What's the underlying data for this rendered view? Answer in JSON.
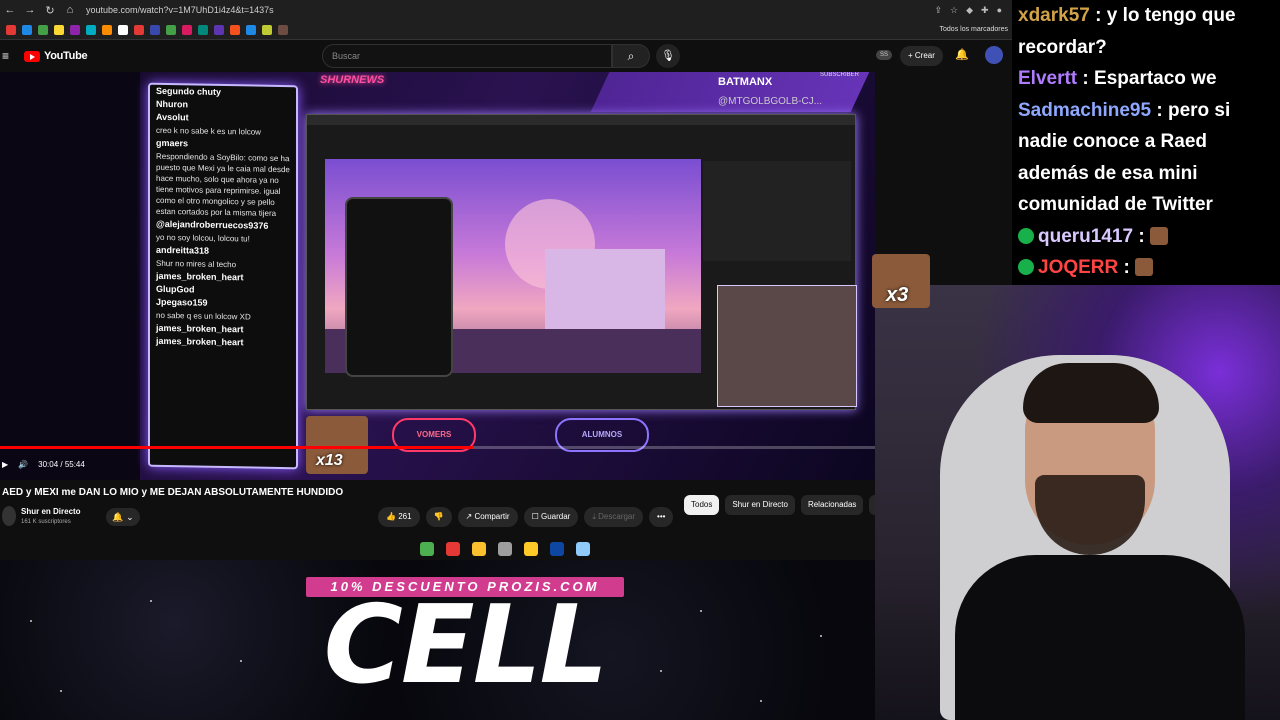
{
  "browser": {
    "url": "youtube.com/watch?v=1M7UhD1i4z4&t=1437s",
    "bookmarks_label": "Todos los marcadores"
  },
  "youtube": {
    "logo": "YouTube",
    "search_placeholder": "Buscar",
    "create_label": "Crear"
  },
  "video": {
    "time": "30:04 / 55:44",
    "progress": 0.54,
    "overlay": {
      "channel_brand": "SHURNEWS",
      "batman": "BATMANX",
      "batman_handle": "@MTGOLBGOLB-CJ...",
      "subscriber": "SUBSCRIBER",
      "zone_left": "VOMERS",
      "zone_right": "ALUMNOS",
      "x13": "x13"
    },
    "chat_lines": [
      {
        "user": "Segundo chuty",
        "text": ""
      },
      {
        "user": "Nhuron",
        "text": ""
      },
      {
        "user": "Avsolut",
        "text": "creo k no sabe k es un lolcow"
      },
      {
        "user": "gmaers",
        "text": "Respondiendo a SoyBilo: como se ha puesto que Mexi ya le caia mal desde hace mucho, solo que ahora ya no tiene motivos para reprimirse. igual como el otro mongolico y se pello estan cortados por la misma tijera"
      },
      {
        "user": "@alejandroberruecos9376",
        "text": "yo no soy lolcou, lolcou tu!"
      },
      {
        "user": "andreitta318",
        "text": "Shur no mires al techo"
      },
      {
        "user": "james_broken_heart",
        "text": ""
      },
      {
        "user": "GlupGod",
        "text": ""
      },
      {
        "user": "Jpegaso159",
        "text": "no sabe q es un lolcow XD"
      },
      {
        "user": "james_broken_heart",
        "text": ""
      },
      {
        "user": "james_broken_heart",
        "text": ""
      }
    ]
  },
  "info": {
    "title": "AED y MEXI me DAN LO MIO y ME DEJAN ABSOLUTAMENTE HUNDIDO",
    "channel": "Shur en Directo",
    "subscribers": "161 K suscriptores",
    "likes": "261",
    "share": "Compartir",
    "save": "Guardar",
    "download": "Descargar",
    "chips": [
      "Todos",
      "Shur en Directo",
      "Relacionadas",
      "Par"
    ]
  },
  "promo": {
    "strip": "10% DESCUENTO PROZIS.COM",
    "big": "CELL"
  },
  "stream_chat": {
    "line0_user": "xdark57",
    "line0_text": ": y lo tengo que",
    "line0b": "recordar?",
    "line1_user": "Elvertt",
    "line1_text": ": Espartaco we",
    "line2_user": "Sadmachine95",
    "line2_text": ": pero si",
    "line2b": "nadie conoce a Raed",
    "line2c": "además de esa mini",
    "line2d": "comunidad de Twitter",
    "line3_user": "queru1417",
    "line3_text": ":",
    "line4_user": "JOQERR",
    "line4_text": ":",
    "emote_label": "x3"
  }
}
